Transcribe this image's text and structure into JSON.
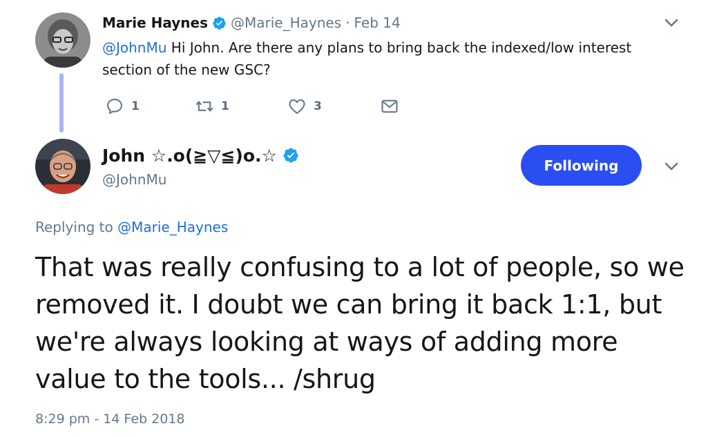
{
  "parent_tweet": {
    "author_name": "Marie Haynes",
    "author_handle": "@Marie_Haynes",
    "separator": "·",
    "date": "Feb 14",
    "mention": "@JohnMu",
    "text_line1": " Hi John. Are there any plans to bring back the indexed/low interest",
    "text_line2": "section of the new GSC?",
    "reply_count": "1",
    "retweet_count": "1",
    "like_count": "3",
    "icons": [
      "reply-icon",
      "retweet-icon",
      "heart-icon",
      "message-icon",
      "chevron-down-icon",
      "verified-badge-icon"
    ]
  },
  "main_tweet": {
    "author_name": "John ☆.o(≧▽≦)o.☆",
    "author_handle": "@JohnMu",
    "follow_label": "Following",
    "replying_prefix": "Replying to ",
    "replying_handle": "@Marie_Haynes",
    "text": "That was really confusing to a lot of people, so we removed it. I doubt we can bring it back 1:1, but we're always looking at ways of adding more value to the tools... /shrug",
    "timestamp": "8:29 pm - 14 Feb 2018"
  },
  "colors": {
    "accent": "#2b4ef2",
    "link": "#1b6fdb",
    "muted": "#657786",
    "thread_line": "#a8b6f5",
    "verified": "#1da1f2"
  }
}
